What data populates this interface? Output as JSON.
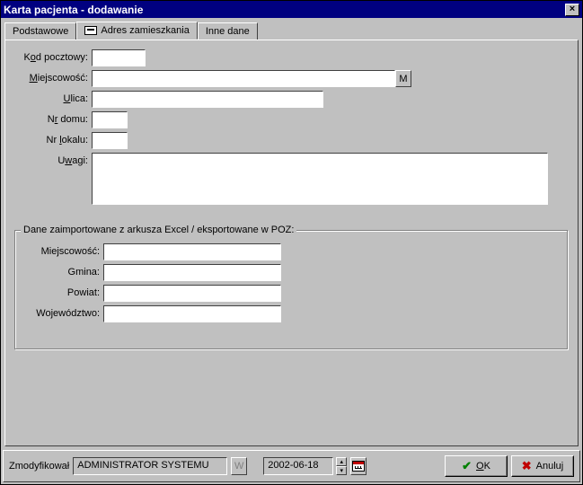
{
  "titlebar": {
    "title": "Karta pacjenta - dodawanie"
  },
  "tabs": {
    "basic": "Podstawowe",
    "address": "Adres zamieszkania",
    "other": "Inne dane"
  },
  "form": {
    "kod_label_pre": "K",
    "kod_label_u": "o",
    "kod_label_post": "d pocztowy:",
    "kod_value": "",
    "miejscowosc_label_u": "M",
    "miejscowosc_label_post": "iejscowość:",
    "miejscowosc_value": "",
    "m_btn": "M",
    "ulica_label_u": "U",
    "ulica_label_post": "lica:",
    "ulica_value": "",
    "nrdomu_label_pre": "N",
    "nrdomu_label_u": "r",
    "nrdomu_label_post": " domu:",
    "nrdomu_value": "",
    "nrlokalu_label_pre": "Nr ",
    "nrlokalu_label_u": "l",
    "nrlokalu_label_post": "okalu:",
    "nrlokalu_value": "",
    "uwagi_label_pre": "U",
    "uwagi_label_u": "w",
    "uwagi_label_post": "agi:",
    "uwagi_value": ""
  },
  "group": {
    "title": "Dane zaimportowane z arkusza Excel / eksportowane w POZ:",
    "miejscowosc_label": "Miejscowość:",
    "miejscowosc_value": "",
    "gmina_label": "Gmina:",
    "gmina_value": "",
    "powiat_label": "Powiat:",
    "powiat_value": "",
    "wojewodztwo_label": "Województwo:",
    "wojewodztwo_value": ""
  },
  "status": {
    "modified_label": "Zmodyfikował",
    "modified_by": "ADMINISTRATOR SYSTEMU",
    "w_btn": "W",
    "date": "2002-06-18",
    "ok_u": "O",
    "ok_post": "K",
    "cancel": "Anuluj"
  }
}
